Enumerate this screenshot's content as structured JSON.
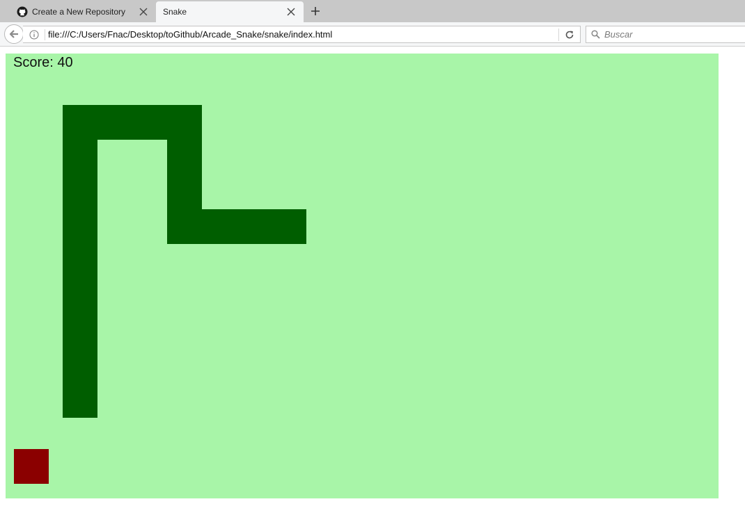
{
  "browser": {
    "tabs": [
      {
        "title": "Create a New Repository",
        "favicon": "github-icon",
        "active": false
      },
      {
        "title": "Snake",
        "favicon": "",
        "active": true
      }
    ],
    "address_bar": {
      "url": "file:///C:/Users/Fnac/Desktop/toGithub/Arcade_Snake/snake/index.html"
    },
    "search_bar": {
      "placeholder": "Buscar"
    }
  },
  "game": {
    "score_label": "Score: 40",
    "colors": {
      "background": "#a8f5a8",
      "snake": "#005e00",
      "food": "#8b0000"
    },
    "grid": {
      "columns": 20,
      "rows": 12.8
    },
    "snake_path_cells": [
      [
        2,
        10
      ],
      [
        2,
        2
      ],
      [
        5,
        2
      ],
      [
        5,
        5
      ],
      [
        8,
        5
      ]
    ],
    "food_cell": [
      0,
      11.4
    ]
  }
}
